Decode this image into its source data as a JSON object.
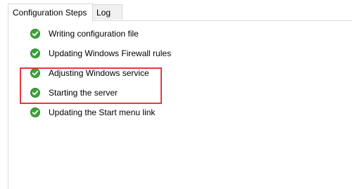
{
  "tabs": [
    {
      "label": "Configuration Steps",
      "active": true
    },
    {
      "label": "Log",
      "active": false
    }
  ],
  "steps": [
    {
      "label": "Writing configuration file",
      "status": "done",
      "icon": "check-circle-icon"
    },
    {
      "label": "Updating Windows Firewall rules",
      "status": "done",
      "icon": "check-circle-icon"
    },
    {
      "label": "Adjusting Windows service",
      "status": "done",
      "icon": "check-circle-icon"
    },
    {
      "label": "Starting the server",
      "status": "done",
      "icon": "check-circle-icon"
    },
    {
      "label": "Updating the Start menu link",
      "status": "done",
      "icon": "check-circle-icon"
    }
  ],
  "colors": {
    "check_green": "#3aa33a",
    "highlight_red": "#e8383d"
  }
}
